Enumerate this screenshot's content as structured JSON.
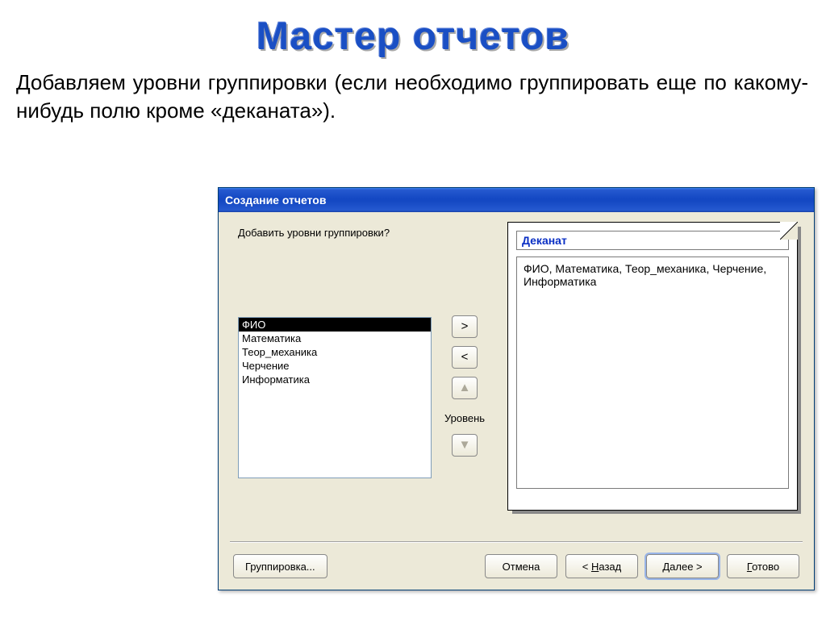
{
  "slide": {
    "title": "Мастер отчетов",
    "description": "Добавляем уровни группировки (если необходимо группировать еще по какому-нибудь полю кроме «деканата»)."
  },
  "dialog": {
    "title": "Создание отчетов",
    "prompt": "Добавить уровни группировки?",
    "fields": [
      "ФИО",
      "Математика",
      "Теор_механика",
      "Черчение",
      "Информатика"
    ],
    "selected_index": 0,
    "buttons": {
      "add": ">",
      "remove": "<",
      "up": "▲",
      "down": "▼",
      "level_label": "Уровень"
    },
    "preview": {
      "group": "Деканат",
      "body": "ФИО, Математика, Теор_механика, Черчение, Информатика"
    },
    "footer": {
      "grouping": "Группировка...",
      "cancel": "Отмена",
      "back_prefix": "< ",
      "back_u": "Н",
      "back_rest": "азад",
      "next_u": "Д",
      "next_rest": "алее >",
      "finish_u": "Г",
      "finish_rest": "отово"
    }
  }
}
